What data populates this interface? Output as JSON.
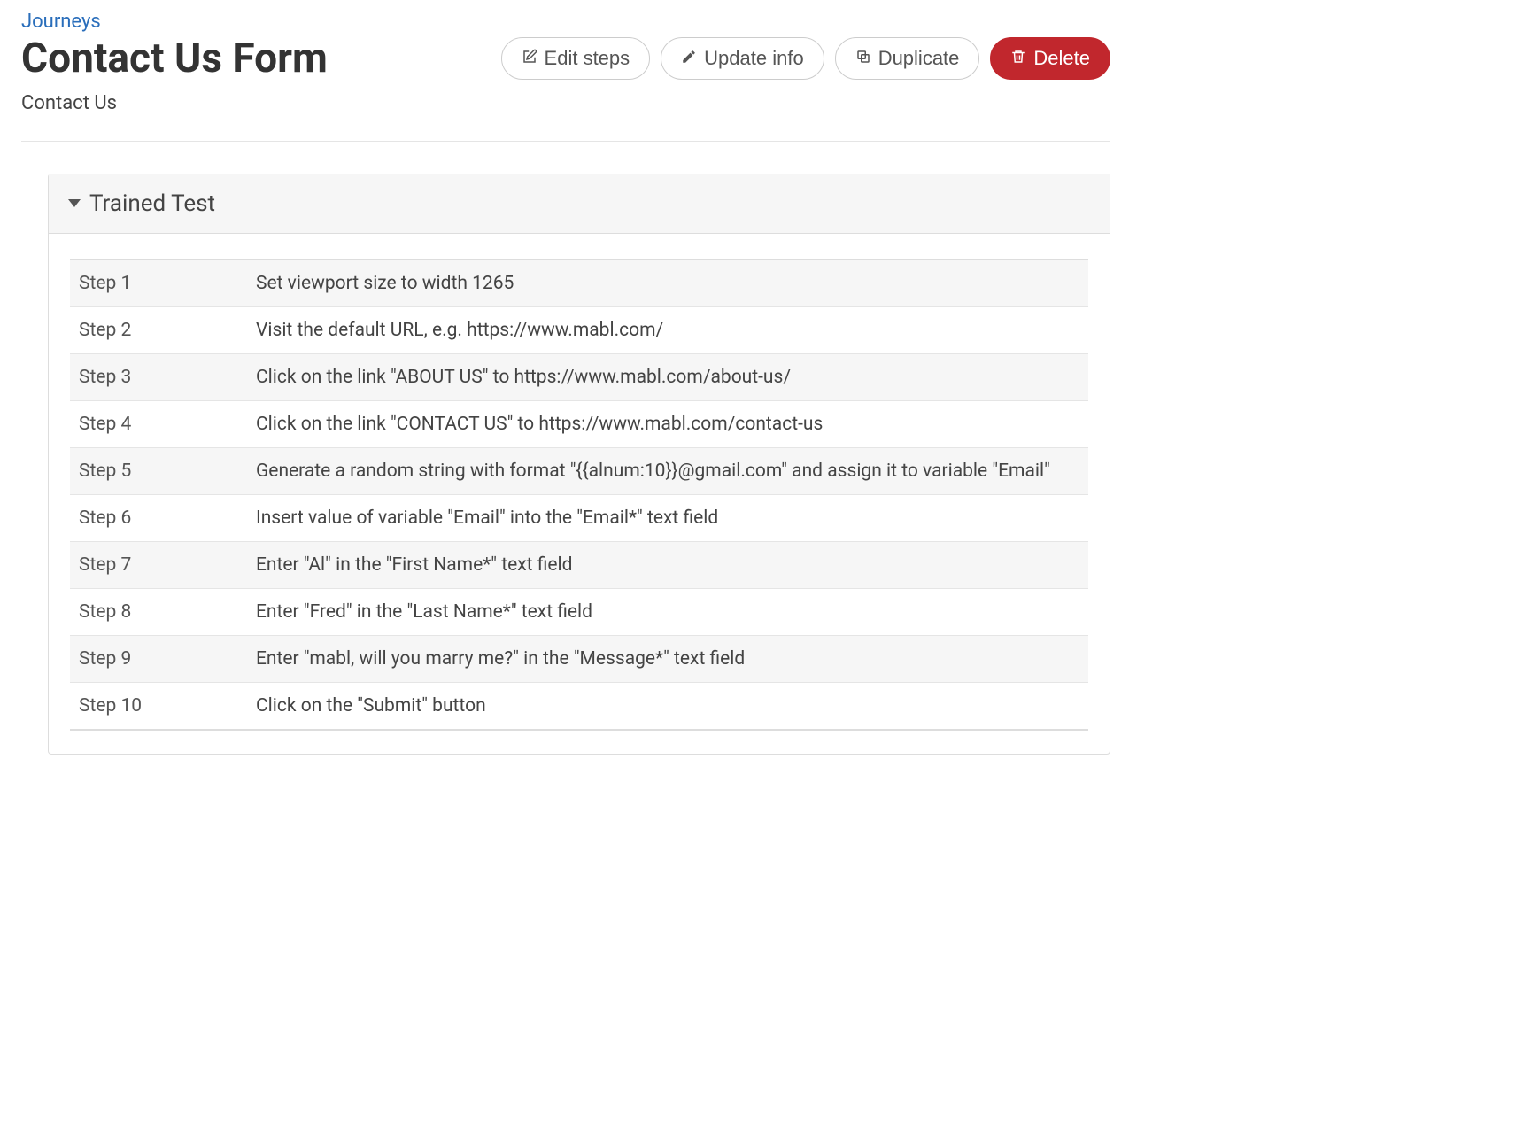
{
  "breadcrumb": "Journeys",
  "title": "Contact Us Form",
  "subtitle": "Contact Us",
  "actions": {
    "edit_steps": "Edit steps",
    "update_info": "Update info",
    "duplicate": "Duplicate",
    "delete": "Delete"
  },
  "panel": {
    "title": "Trained Test",
    "steps": [
      {
        "label": "Step 1",
        "desc": "Set viewport size to width 1265"
      },
      {
        "label": "Step 2",
        "desc": "Visit the default URL, e.g. https://www.mabl.com/"
      },
      {
        "label": "Step 3",
        "desc": "Click on the link \"ABOUT US\" to https://www.mabl.com/about-us/"
      },
      {
        "label": "Step 4",
        "desc": "Click on the link \"CONTACT US\" to https://www.mabl.com/contact-us"
      },
      {
        "label": "Step 5",
        "desc": "Generate a random string with format \"{{alnum:10}}@gmail.com\" and assign it to variable \"Email\""
      },
      {
        "label": "Step 6",
        "desc": "Insert value of variable \"Email\" into the \"Email*\" text field"
      },
      {
        "label": "Step 7",
        "desc": "Enter \"Al\" in the \"First Name*\" text field"
      },
      {
        "label": "Step 8",
        "desc": "Enter \"Fred\" in the \"Last Name*\" text field"
      },
      {
        "label": "Step 9",
        "desc": "Enter \"mabl, will you marry me?\" in the \"Message*\" text field"
      },
      {
        "label": "Step 10",
        "desc": "Click on the \"Submit\" button"
      }
    ]
  }
}
